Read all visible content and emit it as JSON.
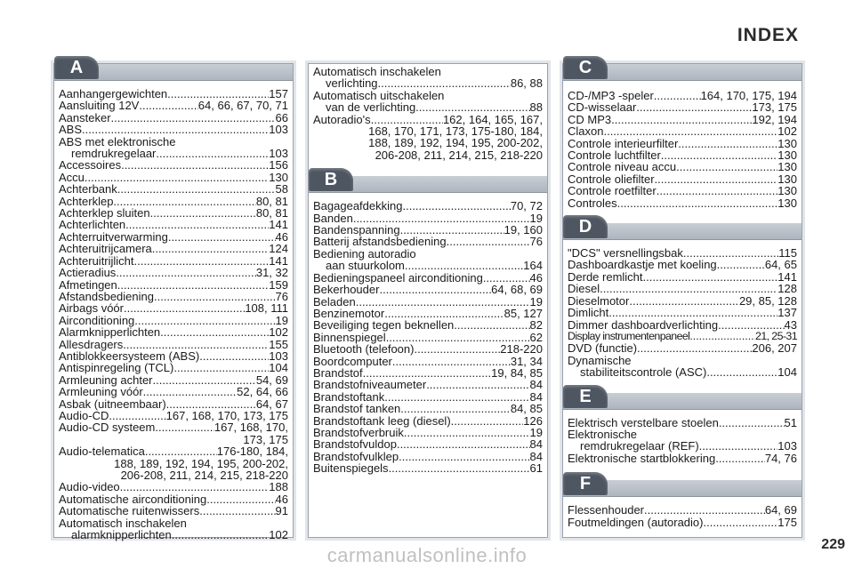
{
  "title": "INDEX",
  "page_number": "229",
  "watermark": "carmanualsonline.info",
  "column1": {
    "letter": "A",
    "rows": [
      {
        "t": "Aanhangergewichten",
        "p": "157"
      },
      {
        "t": "Aansluiting 12V",
        "p": "64, 66, 67, 70, 71"
      },
      {
        "t": "Aansteker",
        "p": "66"
      },
      {
        "t": "ABS",
        "p": "103"
      },
      {
        "c": "ABS met elektronische"
      },
      {
        "t": "remdrukregelaar",
        "p": "103",
        "i": true
      },
      {
        "t": "Accessoires",
        "p": "156"
      },
      {
        "t": "Accu",
        "p": "130"
      },
      {
        "t": "Achterbank",
        "p": "58"
      },
      {
        "t": "Achterklep",
        "p": "80, 81"
      },
      {
        "t": "Achterklep sluiten",
        "p": "80, 81"
      },
      {
        "t": "Achterlichten",
        "p": "141"
      },
      {
        "t": "Achterruitverwarming",
        "p": "46"
      },
      {
        "t": "Achteruitrijcamera",
        "p": "124"
      },
      {
        "t": "Achteruitrijlicht",
        "p": "141"
      },
      {
        "t": "Actieradius",
        "p": "31, 32"
      },
      {
        "t": "Afmetingen",
        "p": "159"
      },
      {
        "t": "Afstandsbediening",
        "p": "76"
      },
      {
        "t": "Airbags vóór",
        "p": "108, 111"
      },
      {
        "t": "Airconditioning",
        "p": "19"
      },
      {
        "t": "Alarmknipperlichten",
        "p": "102"
      },
      {
        "t": "Allesdragers",
        "p": "155"
      },
      {
        "t": "Antiblokkeersysteem (ABS)",
        "p": "103"
      },
      {
        "t": "Antispinregeling (TCL)",
        "p": "104"
      },
      {
        "t": "Armleuning achter",
        "p": "54, 69"
      },
      {
        "t": "Armleuning vóór",
        "p": "52, 64, 66"
      },
      {
        "t": "Asbak (uitneembaar)",
        "p": "64, 67"
      },
      {
        "t": "Audio-CD",
        "p": "167, 168, 170, 173, 175"
      },
      {
        "t": "Audio-CD systeem",
        "p": "167, 168, 170,"
      },
      {
        "c": "173, 175",
        "r": true
      },
      {
        "t": "Audio-telematica",
        "p": "176-180, 184,"
      },
      {
        "c": "188, 189, 192, 194, 195, 200-202,",
        "r": true
      },
      {
        "c": "206-208, 211, 214, 215, 218-220",
        "r": true
      },
      {
        "t": "Audio-video",
        "p": "188"
      },
      {
        "t": "Automatische airconditioning",
        "p": "46"
      },
      {
        "t": "Automatische ruitenwissers",
        "p": "91"
      },
      {
        "c": "Automatisch inschakelen"
      },
      {
        "t": "alarmknipperlichten",
        "p": "102",
        "i": true
      }
    ]
  },
  "column2_top": {
    "rows": [
      {
        "c": "Automatisch inschakelen"
      },
      {
        "t": "verlichting",
        "p": "86, 88",
        "i": true
      },
      {
        "c": "Automatisch uitschakelen"
      },
      {
        "t": "van de verlichting",
        "p": "88",
        "i": true
      },
      {
        "t": "Autoradio's",
        "p": "162, 164, 165, 167,"
      },
      {
        "c": "168, 170, 171, 173, 175-180, 184,",
        "r": true
      },
      {
        "c": "188, 189, 192, 194, 195, 200-202,",
        "r": true
      },
      {
        "c": "206-208, 211, 214, 215, 218-220",
        "r": true
      }
    ]
  },
  "column2_b": {
    "letter": "B",
    "rows": [
      {
        "t": "Bagageafdekking",
        "p": "70, 72"
      },
      {
        "t": "Banden",
        "p": "19"
      },
      {
        "t": "Bandenspanning",
        "p": "19, 160"
      },
      {
        "t": "Batterij afstandsbediening",
        "p": "76"
      },
      {
        "c": "Bediening autoradio"
      },
      {
        "t": "aan stuurkolom",
        "p": "164",
        "i": true
      },
      {
        "t": "Bedieningspaneel airconditioning",
        "p": "46"
      },
      {
        "t": "Bekerhouder",
        "p": "64, 68, 69"
      },
      {
        "t": "Beladen",
        "p": "19"
      },
      {
        "t": "Benzinemotor",
        "p": "85, 127"
      },
      {
        "t": "Beveiliging tegen beknellen",
        "p": "82"
      },
      {
        "t": "Binnenspiegel",
        "p": "62"
      },
      {
        "t": "Bluetooth (telefoon)",
        "p": "218-220"
      },
      {
        "t": "Boordcomputer",
        "p": "31, 34"
      },
      {
        "t": "Brandstof",
        "p": "19, 84, 85"
      },
      {
        "t": "Brandstofniveaumeter",
        "p": "84"
      },
      {
        "t": "Brandstoftank",
        "p": "84"
      },
      {
        "t": "Brandstof tanken",
        "p": "84, 85"
      },
      {
        "t": "Brandstoftank leeg (diesel)",
        "p": "126"
      },
      {
        "t": "Brandstofverbruik",
        "p": "19"
      },
      {
        "t": "Brandstofvuldop",
        "p": "84"
      },
      {
        "t": "Brandstofvulklep",
        "p": "84"
      },
      {
        "t": "Buitenspiegels",
        "p": "61"
      }
    ]
  },
  "column3_c": {
    "letter": "C",
    "rows": [
      {
        "t": "CD-/MP3 -speler",
        "p": "164, 170, 175, 194"
      },
      {
        "t": "CD-wisselaar",
        "p": "173, 175"
      },
      {
        "t": "CD MP3",
        "p": "192, 194"
      },
      {
        "t": "Claxon",
        "p": "102"
      },
      {
        "t": "Controle interieurfilter",
        "p": "130"
      },
      {
        "t": "Controle luchtfilter",
        "p": "130"
      },
      {
        "t": "Controle niveau accu",
        "p": "130"
      },
      {
        "t": "Controle oliefilter",
        "p": "130"
      },
      {
        "t": "Controle roetfilter",
        "p": "130"
      },
      {
        "t": "Controles",
        "p": "130"
      }
    ]
  },
  "column3_d": {
    "letter": "D",
    "rows": [
      {
        "t": "\"DCS\" versnellingsbak",
        "p": "115"
      },
      {
        "t": "Dashboardkastje met koeling",
        "p": "64, 65"
      },
      {
        "t": "Derde remlicht",
        "p": "141"
      },
      {
        "t": "Diesel",
        "p": "128"
      },
      {
        "t": "Dieselmotor",
        "p": "29, 85, 128"
      },
      {
        "t": "Dimlicht",
        "p": "137"
      },
      {
        "t": "Dimmer dashboardverlichting",
        "p": "43"
      },
      {
        "t": "Display instrumentenpaneel",
        "p": "21, 25-31",
        "k": true
      },
      {
        "t": "DVD (functie)",
        "p": "206, 207"
      },
      {
        "c": "Dynamische"
      },
      {
        "t": "stabiliteitscontrole (ASC)",
        "p": "104",
        "i": true
      }
    ]
  },
  "column3_e": {
    "letter": "E",
    "rows": [
      {
        "t": "Elektrisch verstelbare stoelen",
        "p": "51"
      },
      {
        "c": "Elektronische"
      },
      {
        "t": "remdrukregelaar (REF)",
        "p": "103",
        "i": true
      },
      {
        "t": "Elektronische startblokkering",
        "p": "74, 76"
      }
    ]
  },
  "column3_f": {
    "letter": "F",
    "rows": [
      {
        "t": "Flessenhouder",
        "p": "64, 69"
      },
      {
        "t": "Foutmeldingen (autoradio)",
        "p": "175"
      }
    ]
  }
}
